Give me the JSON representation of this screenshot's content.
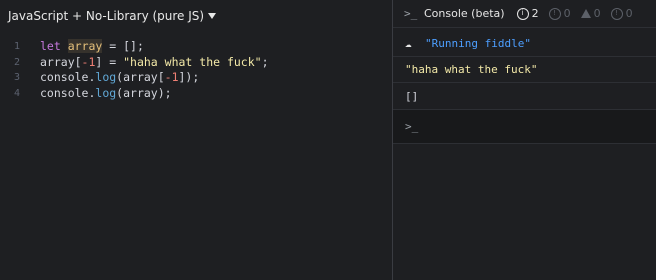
{
  "editor": {
    "language_label": "JavaScript + No-Library (pure JS)",
    "lines": [
      {
        "number": "1",
        "tokens": [
          {
            "t": "let",
            "c": "kw"
          },
          {
            "t": " ",
            "c": "plain"
          },
          {
            "t": "array",
            "c": "var"
          },
          {
            "t": " = [];",
            "c": "plain"
          }
        ]
      },
      {
        "number": "2",
        "tokens": [
          {
            "t": "array[",
            "c": "plain"
          },
          {
            "t": "-1",
            "c": "num"
          },
          {
            "t": "] = ",
            "c": "plain"
          },
          {
            "t": "\"haha what the fuck\"",
            "c": "str"
          },
          {
            "t": ";",
            "c": "plain"
          }
        ]
      },
      {
        "number": "3",
        "tokens": [
          {
            "t": "console.",
            "c": "plain"
          },
          {
            "t": "log",
            "c": "fn"
          },
          {
            "t": "(array[",
            "c": "plain"
          },
          {
            "t": "-1",
            "c": "num"
          },
          {
            "t": "]);",
            "c": "plain"
          }
        ]
      },
      {
        "number": "4",
        "tokens": [
          {
            "t": "console.",
            "c": "plain"
          },
          {
            "t": "log",
            "c": "fn"
          },
          {
            "t": "(array);",
            "c": "plain"
          }
        ]
      }
    ]
  },
  "console": {
    "prompt_icon": ">_",
    "title": "Console (beta)",
    "counters": {
      "info": "2",
      "error": "0",
      "warning": "0",
      "debug": "0"
    },
    "rows": {
      "running": "\"Running fiddle\"",
      "string_output": "\"haha what the fuck\"",
      "array_output": "[]"
    },
    "input_prompt": ">_"
  },
  "colors": {
    "background": "#1e1f22",
    "keyword": "#c678dd",
    "string": "#f3e9a8",
    "number": "#ef7f74",
    "function": "#61a8d6",
    "info": "#4d9fff"
  }
}
